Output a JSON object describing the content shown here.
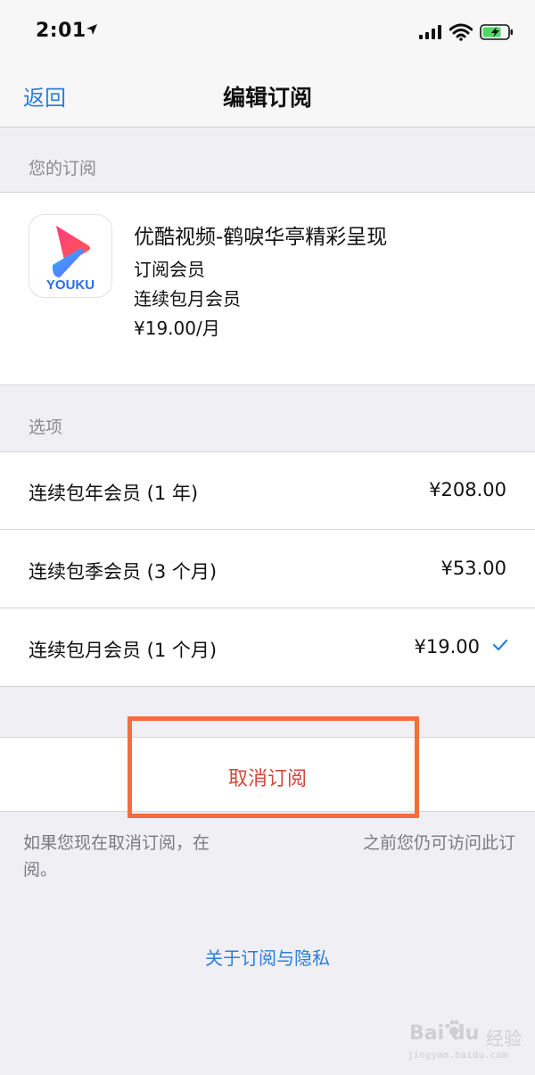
{
  "status_bar": {
    "time": "2:01"
  },
  "nav": {
    "back_label": "返回",
    "title": "编辑订阅"
  },
  "subscription": {
    "section_title": "您的订阅",
    "app_icon_text": "YOUKU",
    "app_name": "优酷视频-鹤唳华亭精彩呈现",
    "type": "订阅会员",
    "plan": "连续包月会员",
    "price": "¥19.00/月"
  },
  "options": {
    "section_title": "选项",
    "items": [
      {
        "label": "连续包年会员 (1 年)",
        "price": "¥208.00",
        "selected": false
      },
      {
        "label": "连续包季会员 (3 个月)",
        "price": "¥53.00",
        "selected": false
      },
      {
        "label": "连续包月会员 (1 个月)",
        "price": "¥19.00",
        "selected": true
      }
    ]
  },
  "cancel": {
    "label": "取消订阅"
  },
  "footnote": {
    "part1": "如果您现在取消订阅，在",
    "part2": "之前您仍可访问此订阅。"
  },
  "privacy_link": "关于订阅与隐私",
  "watermark": {
    "logo": "Bai du",
    "brand": "经验",
    "url": "jingyan.baidu.com"
  },
  "colors": {
    "accent": "#2d7fd8",
    "destructive": "#d3483b",
    "highlight_box": "#f36e3c",
    "background": "#efeff4"
  }
}
